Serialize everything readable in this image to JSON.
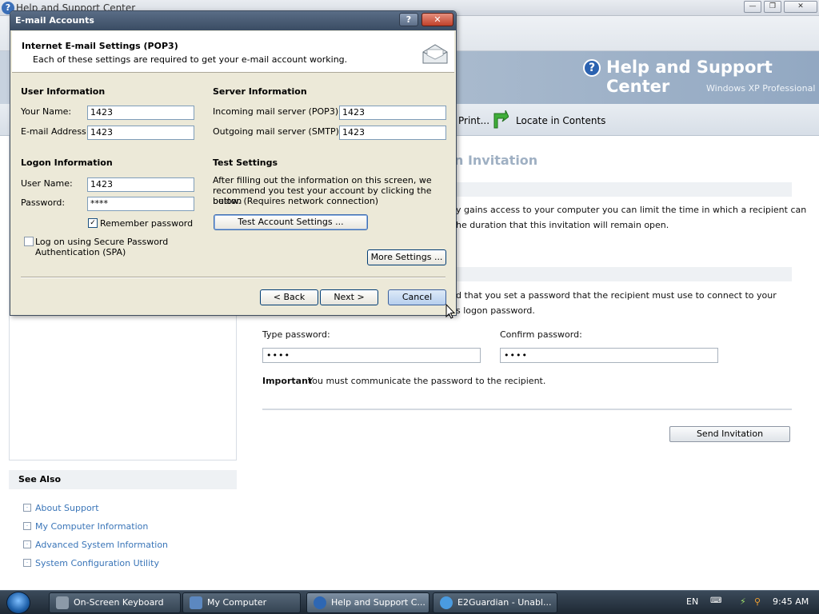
{
  "hsc": {
    "window_title": "Help and Support Center",
    "banner_title": "Help and Support Center",
    "banner_subtitle": "Windows XP Professional",
    "toolbar": {
      "print_label": "Print...",
      "locate_label": "Locate in Contents"
    },
    "heading_partial": "n Invitation",
    "text_1a": "y gains access to your computer you can limit the time in which a recipient can",
    "text_1b": "he duration that this invitation will remain open.",
    "text_2a": "d that you set a password that the recipient must use to connect to your",
    "text_2b": "s logon password.",
    "type_password_label": "Type password:",
    "type_password_value": "••••",
    "confirm_password_label": "Confirm password:",
    "confirm_password_value": "••••",
    "important_label": "Important",
    "important_text": "You must communicate the password to the recipient.",
    "send_button": "Send Invitation",
    "see_also": {
      "title": "See Also",
      "items": [
        "About Support",
        "My Computer Information",
        "Advanced System Information",
        "System Configuration Utility"
      ]
    }
  },
  "dialog": {
    "title": "E-mail Accounts",
    "help_btn": "?",
    "close_btn": "✕",
    "header_title": "Internet E-mail Settings (POP3)",
    "header_subtitle": "Each of these settings are required to get your e-mail account working.",
    "user_info": {
      "title": "User Information",
      "name_label": "Your Name:",
      "name_value": "1423",
      "email_label": "E-mail Address:",
      "email_value": "1423"
    },
    "server_info": {
      "title": "Server Information",
      "incoming_label": "Incoming mail server (POP3):",
      "incoming_value": "1423",
      "outgoing_label": "Outgoing mail server (SMTP):",
      "outgoing_value": "1423"
    },
    "logon_info": {
      "title": "Logon Information",
      "username_label": "User Name:",
      "username_value": "1423",
      "password_label": "Password:",
      "password_value": "****",
      "remember_label": "Remember password",
      "remember_checked": true,
      "spa_label_1": "Log on using Secure Password",
      "spa_label_2": "Authentication (SPA)",
      "spa_checked": false
    },
    "test_settings": {
      "title": "Test Settings",
      "desc_1": "After filling out the information on this screen, we",
      "desc_2": "recommend you test your account by clicking the button",
      "desc_3": "below. (Requires network connection)",
      "test_button": "Test Account Settings ..."
    },
    "more_settings_button": "More Settings ...",
    "back_button": "< Back",
    "next_button": "Next >",
    "cancel_button": "Cancel"
  },
  "taskbar": {
    "tasks": [
      "On-Screen Keyboard",
      "My Computer",
      "Help and Support C...",
      "E2Guardian - Unabl..."
    ],
    "language": "EN",
    "clock": "9:45 AM"
  }
}
